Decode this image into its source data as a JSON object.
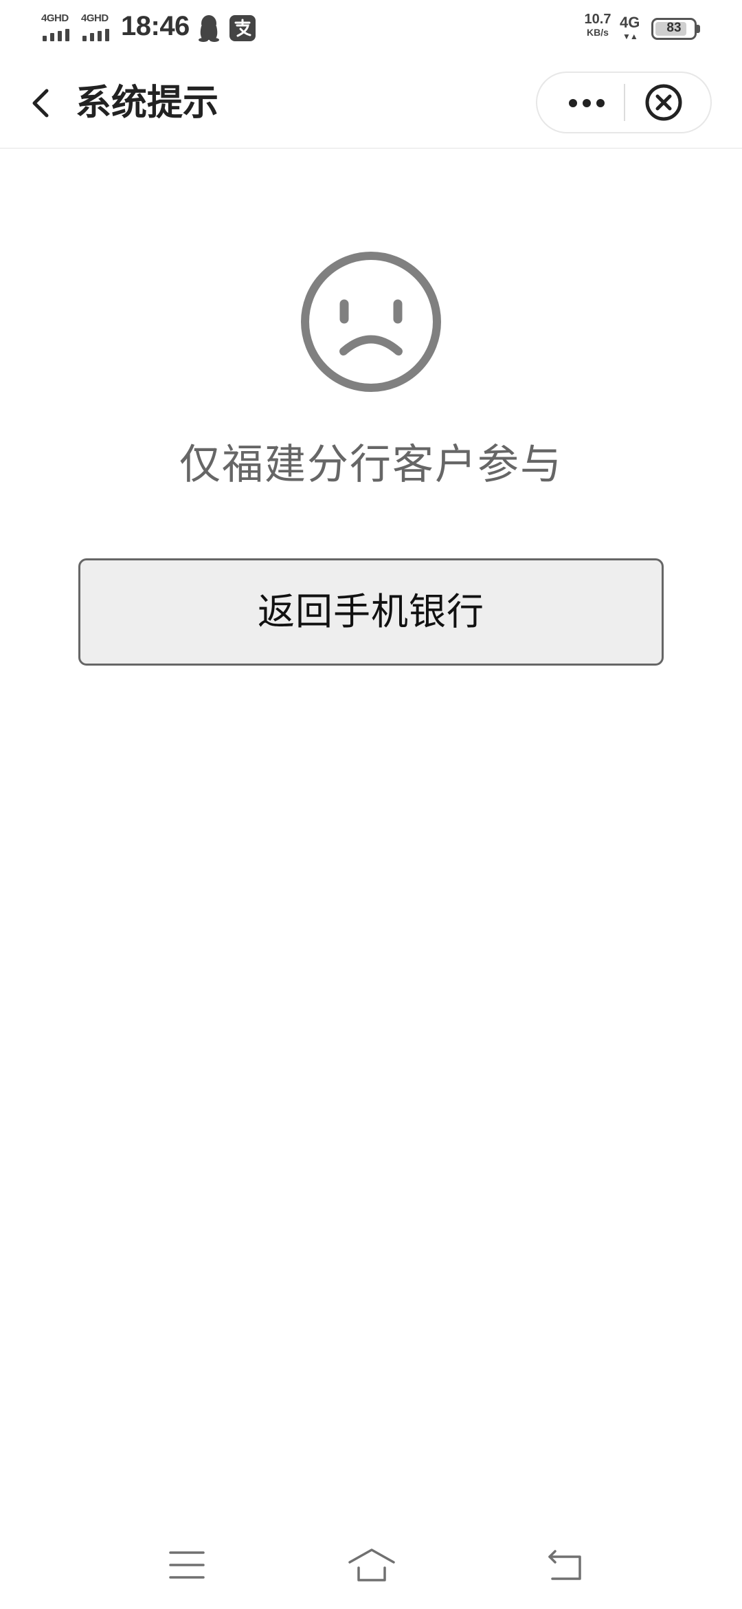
{
  "status_bar": {
    "signal_1_label": "4GHD",
    "signal_2_label": "4GHD",
    "time": "18:46",
    "notification_icons": [
      "qq-icon",
      "alipay-icon"
    ],
    "net_speed_value": "10.7",
    "net_speed_unit": "KB/s",
    "network_type": "4G",
    "network_activity": "▼▲",
    "battery_level": 83,
    "battery_text": "83"
  },
  "nav": {
    "title": "系统提示",
    "back_icon": "chevron-left-icon",
    "more_icon": "more-dots-icon",
    "close_icon": "close-circle-icon"
  },
  "content": {
    "icon": "sad-face-icon",
    "message": "仅福建分行客户参与",
    "return_button_label": "返回手机银行"
  },
  "system_nav": {
    "menu_icon": "menu-lines-icon",
    "home_icon": "home-icon",
    "back_icon": "back-arrow-icon"
  },
  "colors": {
    "icon_gray": "#808080",
    "message_gray": "#666666",
    "button_bg": "#eeeeee",
    "button_border": "#666666"
  }
}
